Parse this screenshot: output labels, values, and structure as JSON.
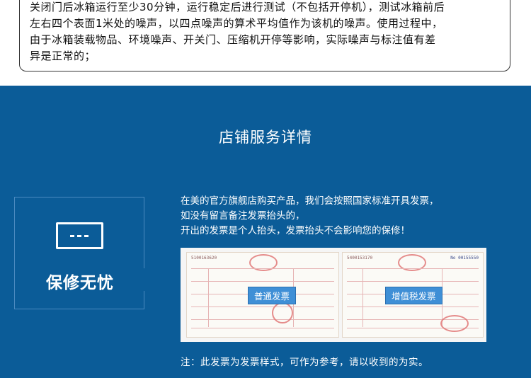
{
  "notice": {
    "lines": [
      "关闭门后冰箱运行至少30分钟，运行稳定后进行测试（不包括开停机），测试冰箱前后",
      "左右四个表面1米处的噪声，以四点噪声的算术平均值作为该机的噪声。使用过程中，",
      "由于冰箱装载物品、环境噪声、开关门、压缩机开停等影响，实际噪声与标注值有差",
      "异是正常的；"
    ]
  },
  "service": {
    "title": "店铺服务详情",
    "box_label": "保修无忧",
    "icon": "card-icon",
    "info_lines": [
      "在美的官方旗舰店购买产品，我们会按照国家标准开具发票，",
      "如没有留言备注发票抬头的，",
      "开出的发票是个人抬头，发票抬头不会影响您的保修！"
    ],
    "invoices": {
      "general_label": "普通发票",
      "vat_label": "增值税发票",
      "general_code": "5100163620",
      "vat_code": "5400153170",
      "vat_no": "No 00155550"
    },
    "note": "注：此发票为发票样式，可作为参考，请以收到的为实。"
  },
  "colors": {
    "section_bg": "#0b5c98",
    "tag_bg": "#3f8fd6"
  }
}
